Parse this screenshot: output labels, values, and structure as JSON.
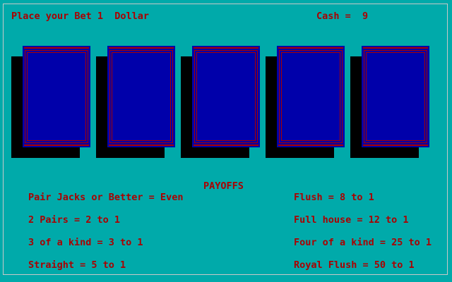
{
  "header": {
    "bet_text": "Place your Bet 1  Dollar",
    "cash_text": "Cash =  9"
  },
  "cards": [
    {
      "state": "face-down"
    },
    {
      "state": "face-down"
    },
    {
      "state": "face-down"
    },
    {
      "state": "face-down"
    },
    {
      "state": "face-down"
    }
  ],
  "payoffs": {
    "title": "PAYOFFS",
    "left": [
      "Pair Jacks or Better = Even",
      "2 Pairs = 2 to 1",
      "3 of a kind = 3 to 1",
      "Straight = 5 to 1"
    ],
    "right": [
      "Flush = 8 to 1",
      "Full house = 12 to 1",
      "Four of a kind = 25 to 1",
      "Royal Flush = 50 to 1"
    ]
  },
  "colors": {
    "background": "#00AAAA",
    "text": "#AA0000",
    "card_back": "#0000AA",
    "shadow": "#000000"
  }
}
